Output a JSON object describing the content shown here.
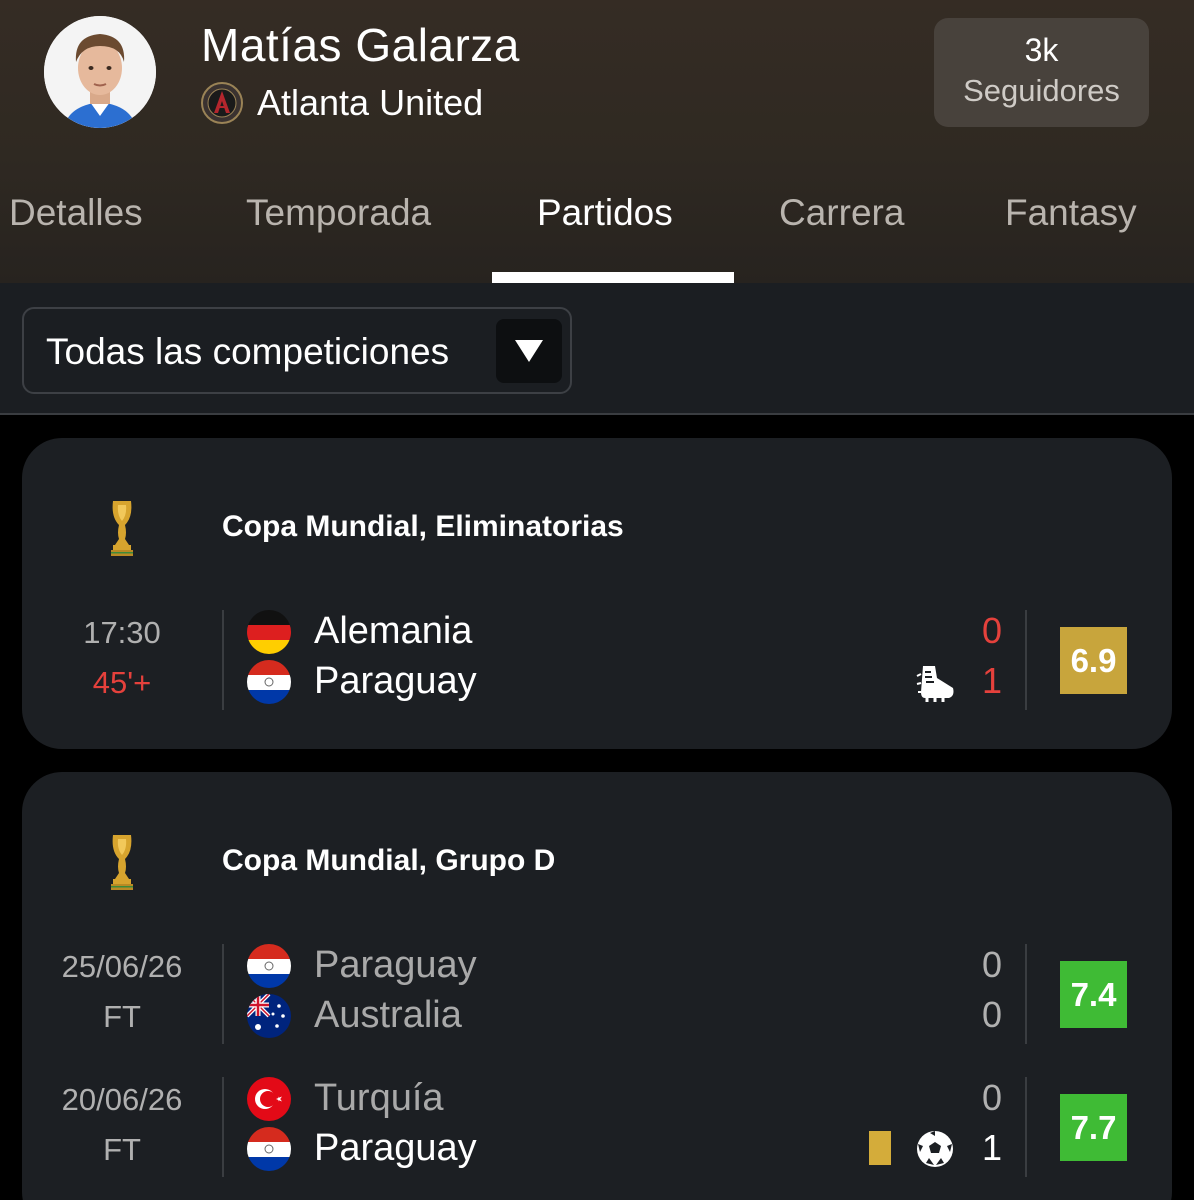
{
  "player": {
    "name": "Matías Galarza",
    "team": "Atlanta United",
    "followers_count": "3k",
    "followers_label": "Seguidores"
  },
  "tabs": [
    {
      "label": "Detalles",
      "active": false
    },
    {
      "label": "Temporada",
      "active": false
    },
    {
      "label": "Partidos",
      "active": true
    },
    {
      "label": "Carrera",
      "active": false
    },
    {
      "label": "Fantasy",
      "active": false
    }
  ],
  "filter": {
    "selected": "Todas las competiciones"
  },
  "competitions": [
    {
      "name": "Copa Mundial, Eliminatorias",
      "icon": "trophy-icon",
      "matches": [
        {
          "time": "17:30",
          "status": "45'+",
          "status_live": true,
          "home": {
            "name": "Alemania",
            "score": "0",
            "flag": "germany-flag-icon"
          },
          "away": {
            "name": "Paraguay",
            "score": "1",
            "flag": "paraguay-flag-icon",
            "event": "assist-boot-icon"
          },
          "rating": "6.9",
          "rating_color": "#c8a53c"
        }
      ]
    },
    {
      "name": "Copa Mundial, Grupo D",
      "icon": "trophy-icon",
      "matches": [
        {
          "time": "25/06/26",
          "status": "FT",
          "status_live": false,
          "home": {
            "name": "Paraguay",
            "score": "0",
            "flag": "paraguay-flag-icon"
          },
          "away": {
            "name": "Australia",
            "score": "0",
            "flag": "australia-flag-icon"
          },
          "rating": "7.4",
          "rating_color": "#3fbb35"
        },
        {
          "time": "20/06/26",
          "status": "FT",
          "status_live": false,
          "home": {
            "name": "Turquía",
            "score": "0",
            "flag": "turkey-flag-icon"
          },
          "away": {
            "name": "Paraguay",
            "score": "1",
            "flag": "paraguay-flag-icon",
            "events": [
              "yellow-card-icon",
              "goal-ball-icon"
            ]
          },
          "rating": "7.7",
          "rating_color": "#3fbb35"
        }
      ]
    }
  ]
}
